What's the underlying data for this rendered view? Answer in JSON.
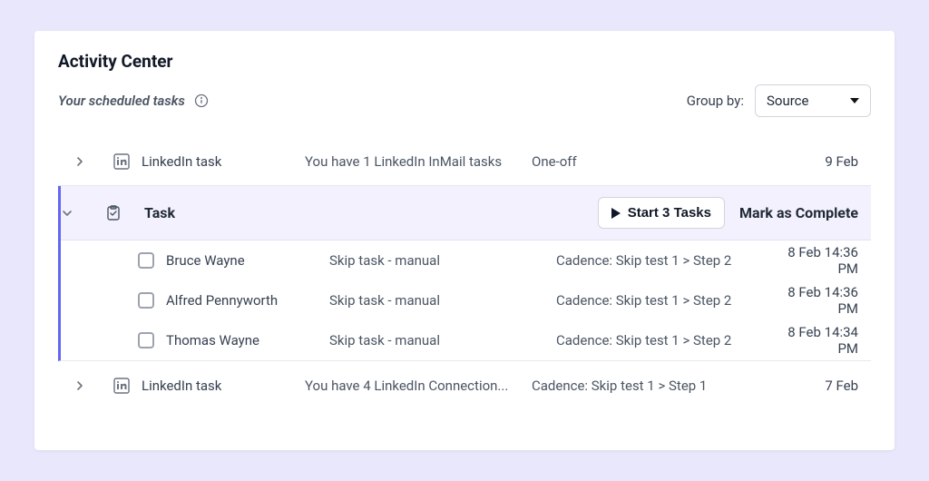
{
  "header": {
    "title": "Activity Center",
    "subtitle": "Your scheduled tasks"
  },
  "group_by": {
    "label": "Group by:",
    "selected": "Source"
  },
  "groups": [
    {
      "type": "linkedin",
      "expanded": false,
      "label": "LinkedIn task",
      "summary": "You have 1 LinkedIn InMail tasks",
      "cadence": "One-off",
      "date": "9 Feb"
    },
    {
      "type": "task",
      "expanded": true,
      "label": "Task",
      "start_label": "Start 3 Tasks",
      "mark_label": "Mark as Complete",
      "items": [
        {
          "name": "Bruce Wayne",
          "action": "Skip task - manual",
          "cadence": "Cadence: Skip test 1 > Step 2",
          "time": "8 Feb 14:36 PM"
        },
        {
          "name": "Alfred Pennyworth",
          "action": "Skip task - manual",
          "cadence": "Cadence: Skip test 1 > Step 2",
          "time": "8 Feb 14:36 PM"
        },
        {
          "name": "Thomas Wayne",
          "action": "Skip task - manual",
          "cadence": "Cadence: Skip test 1 > Step 2",
          "time": "8 Feb 14:34 PM"
        }
      ]
    },
    {
      "type": "linkedin",
      "expanded": false,
      "label": "LinkedIn task",
      "summary": "You have 4 LinkedIn Connection...",
      "cadence": "Cadence: Skip test 1 > Step 1",
      "date": "7 Feb"
    }
  ]
}
